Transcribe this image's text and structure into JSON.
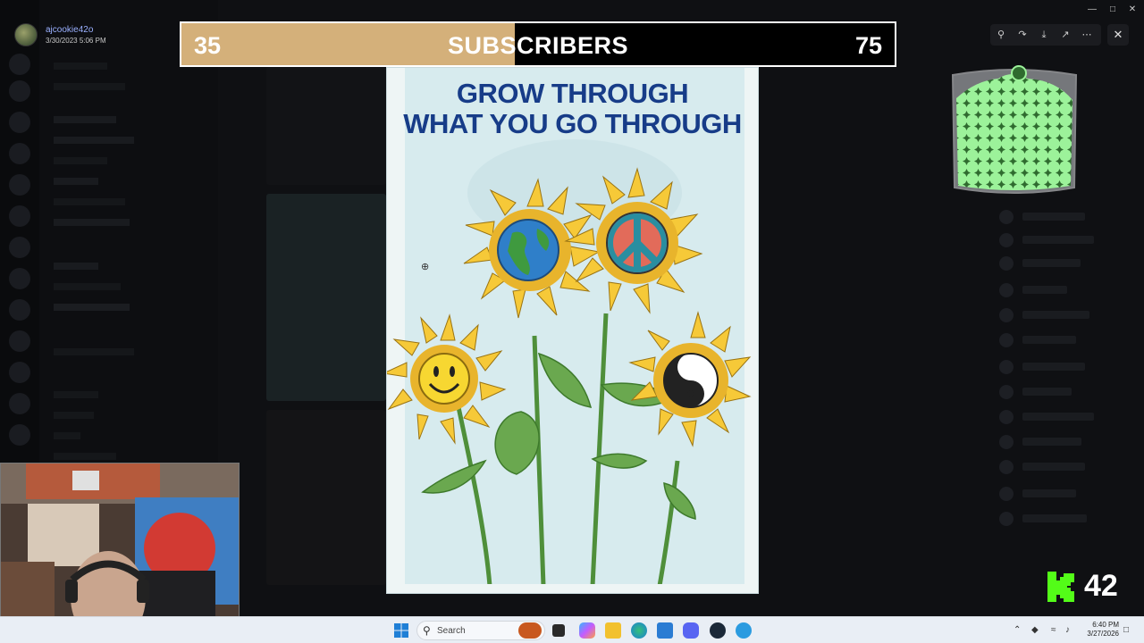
{
  "user": {
    "name": "ajcookie42o",
    "timestamp": "3/30/2023 5:06 PM"
  },
  "subscriber_goal": {
    "current": "35",
    "label": "SUBSCRIBERS",
    "goal": "75",
    "progress_fraction": 0.467,
    "fill_color": "#d4b07a"
  },
  "poster": {
    "title_line1": "GROW THROUGH",
    "title_line2": "WHAT YOU GO THROUGH",
    "title_color": "#173c88",
    "flower_icons": [
      "earth-icon",
      "peace-sign-icon",
      "smiley-face-icon",
      "yin-yang-icon"
    ]
  },
  "viewer_tools": [
    "zoom-icon",
    "forward-icon",
    "download-icon",
    "open-external-icon",
    "more-icon"
  ],
  "kick": {
    "count": "42",
    "color": "#53fc18"
  },
  "taskbar": {
    "search_placeholder": "Search",
    "time": "6:40 PM",
    "date": "3/27/2026"
  }
}
